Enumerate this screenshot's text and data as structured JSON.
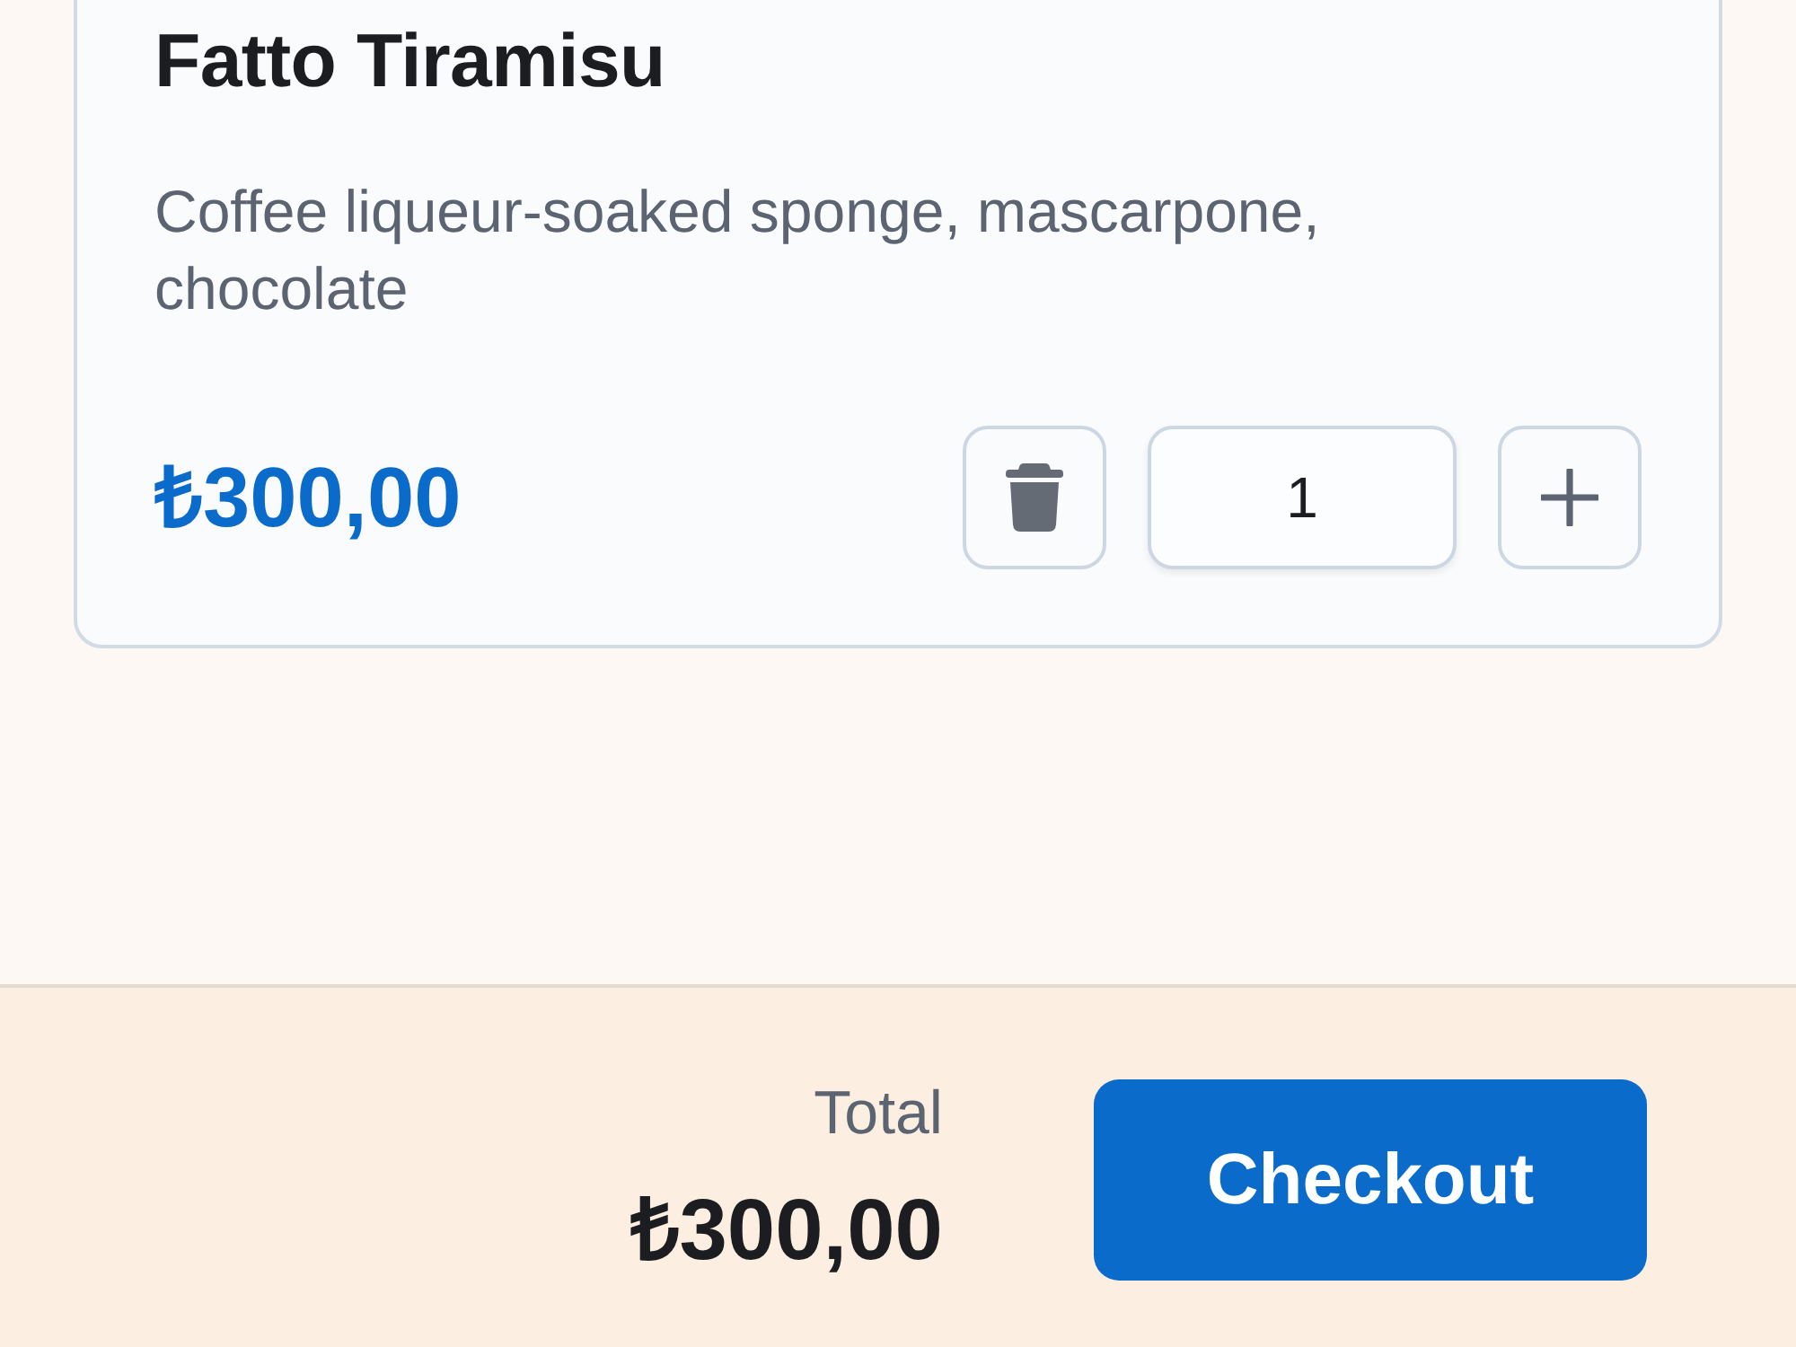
{
  "items": [
    {
      "name": "Fatto Tiramisu",
      "description": "Coffee liqueur-soaked sponge, mascarpone, chocolate",
      "price": "₺300,00",
      "quantity": "1"
    }
  ],
  "footer": {
    "total_label": "Total",
    "total": "₺300,00",
    "checkout_button": "Checkout"
  }
}
